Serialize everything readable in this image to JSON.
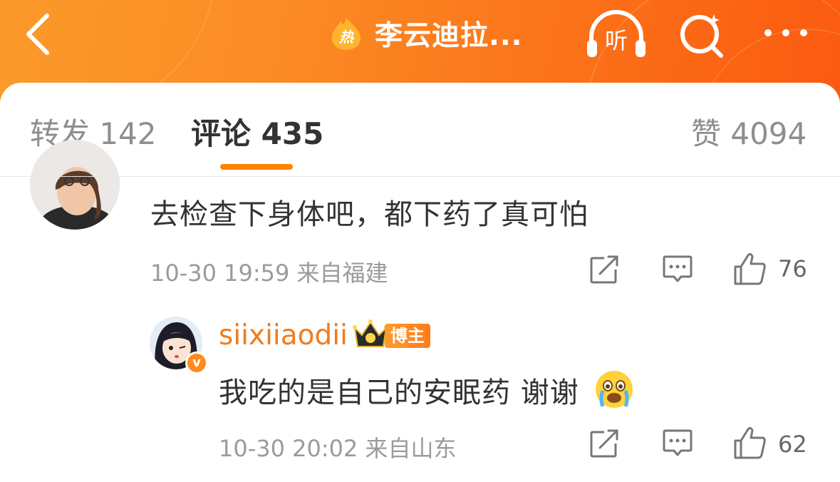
{
  "header": {
    "title": "李云迪拉...",
    "hot_badge": "热",
    "listen_label": "听",
    "icons": [
      "back-arrow-icon",
      "hot-icon",
      "listen-headphones-icon",
      "search-icon",
      "more-icon"
    ]
  },
  "tabs": {
    "repost": "转发 142",
    "comments": "评论 435",
    "likes": "赞 4094"
  },
  "comments": [
    {
      "text": "去检查下身体吧，都下药了真可怕",
      "meta": "10-30 19:59 来自福建",
      "like_count": "76"
    }
  ],
  "reply": {
    "username": "siixiiaodii",
    "badge": "博主",
    "verified_mark": "v",
    "text": "我吃的是自己的安眠药 谢谢",
    "emoji": "crying-face",
    "meta": "10-30 20:02 来自山东",
    "like_count": "62"
  },
  "colors": {
    "header_orange": "#fb7a1c",
    "accent": "#ff8200",
    "username": "#f07c1e"
  }
}
